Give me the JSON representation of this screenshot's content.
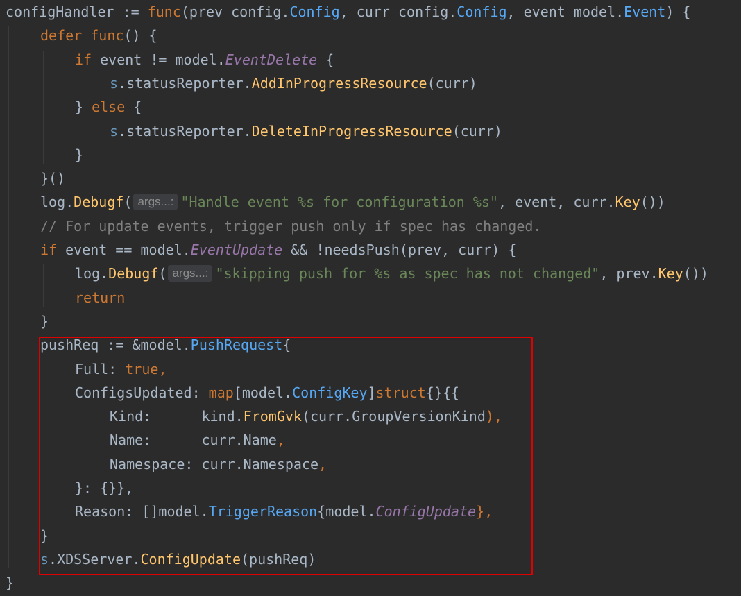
{
  "editor": {
    "highlight_color": "#e00000",
    "lines": [
      {
        "indent": 0,
        "tokens": [
          {
            "t": "configHandler",
            "c": "var"
          },
          {
            "t": " := ",
            "c": "punc"
          },
          {
            "t": "func",
            "c": "kw"
          },
          {
            "t": "(prev ",
            "c": "var"
          },
          {
            "t": "config",
            "c": "pkg"
          },
          {
            "t": ".",
            "c": "punc"
          },
          {
            "t": "Config",
            "c": "typeblue"
          },
          {
            "t": ", curr ",
            "c": "var"
          },
          {
            "t": "config",
            "c": "pkg"
          },
          {
            "t": ".",
            "c": "punc"
          },
          {
            "t": "Config",
            "c": "typeblue"
          },
          {
            "t": ", event ",
            "c": "var"
          },
          {
            "t": "model",
            "c": "pkg"
          },
          {
            "t": ".",
            "c": "punc"
          },
          {
            "t": "Event",
            "c": "typeblue"
          },
          {
            "t": ") {",
            "c": "punc"
          }
        ]
      },
      {
        "indent": 1,
        "tokens": [
          {
            "t": "defer ",
            "c": "kw"
          },
          {
            "t": "func",
            "c": "kw"
          },
          {
            "t": "() {",
            "c": "punc"
          }
        ]
      },
      {
        "indent": 2,
        "tokens": [
          {
            "t": "if ",
            "c": "kw"
          },
          {
            "t": "event != ",
            "c": "var"
          },
          {
            "t": "model",
            "c": "pkg"
          },
          {
            "t": ".",
            "c": "punc"
          },
          {
            "t": "EventDelete",
            "c": "const"
          },
          {
            "t": " {",
            "c": "punc"
          }
        ]
      },
      {
        "indent": 3,
        "tokens": [
          {
            "t": "s",
            "c": "recv"
          },
          {
            "t": ".statusReporter.",
            "c": "var"
          },
          {
            "t": "AddInProgressResource",
            "c": "method"
          },
          {
            "t": "(curr)",
            "c": "punc"
          }
        ]
      },
      {
        "indent": 2,
        "tokens": [
          {
            "t": "} ",
            "c": "punc"
          },
          {
            "t": "else",
            "c": "kw"
          },
          {
            "t": " {",
            "c": "punc"
          }
        ]
      },
      {
        "indent": 3,
        "tokens": [
          {
            "t": "s",
            "c": "recv"
          },
          {
            "t": ".statusReporter.",
            "c": "var"
          },
          {
            "t": "DeleteInProgressResource",
            "c": "method"
          },
          {
            "t": "(curr)",
            "c": "punc"
          }
        ]
      },
      {
        "indent": 2,
        "tokens": [
          {
            "t": "}",
            "c": "punc"
          }
        ]
      },
      {
        "indent": 1,
        "tokens": [
          {
            "t": "}()",
            "c": "punc"
          }
        ]
      },
      {
        "indent": 1,
        "tokens": [
          {
            "t": "log",
            "c": "pkg"
          },
          {
            "t": ".",
            "c": "punc"
          },
          {
            "t": "Debugf",
            "c": "method"
          },
          {
            "t": "(",
            "c": "punc"
          },
          {
            "hint": "args...:"
          },
          {
            "t": "\"Handle event %s for configuration %s\"",
            "c": "str"
          },
          {
            "t": ", event, curr.",
            "c": "var"
          },
          {
            "t": "Key",
            "c": "method"
          },
          {
            "t": "())",
            "c": "punc"
          }
        ]
      },
      {
        "indent": 1,
        "tokens": [
          {
            "t": "// For update events, trigger push only if spec has changed.",
            "c": "cm"
          }
        ]
      },
      {
        "indent": 1,
        "tokens": [
          {
            "t": "if ",
            "c": "kw"
          },
          {
            "t": "event == ",
            "c": "var"
          },
          {
            "t": "model",
            "c": "pkg"
          },
          {
            "t": ".",
            "c": "punc"
          },
          {
            "t": "EventUpdate",
            "c": "const"
          },
          {
            "t": " && !",
            "c": "punc"
          },
          {
            "t": "needsPush",
            "c": "meth2"
          },
          {
            "t": "(prev, curr) {",
            "c": "punc"
          }
        ]
      },
      {
        "indent": 2,
        "tokens": [
          {
            "t": "log",
            "c": "pkg"
          },
          {
            "t": ".",
            "c": "punc"
          },
          {
            "t": "Debugf",
            "c": "method"
          },
          {
            "t": "(",
            "c": "punc"
          },
          {
            "hint": "args...:"
          },
          {
            "t": "\"skipping push for %s as spec has not changed\"",
            "c": "str"
          },
          {
            "t": ", prev.",
            "c": "var"
          },
          {
            "t": "Key",
            "c": "method"
          },
          {
            "t": "())",
            "c": "punc"
          }
        ]
      },
      {
        "indent": 2,
        "tokens": [
          {
            "t": "return",
            "c": "kw"
          }
        ]
      },
      {
        "indent": 1,
        "tokens": [
          {
            "t": "}",
            "c": "punc"
          }
        ]
      },
      {
        "indent": 1,
        "tokens": [
          {
            "t": "pushReq",
            "c": "var"
          },
          {
            "t": " := &",
            "c": "punc"
          },
          {
            "t": "model",
            "c": "pkg"
          },
          {
            "t": ".",
            "c": "punc"
          },
          {
            "t": "PushRequest",
            "c": "typeblue"
          },
          {
            "t": "{",
            "c": "punc"
          }
        ]
      },
      {
        "indent": 2,
        "tokens": [
          {
            "t": "Full",
            "c": "field"
          },
          {
            "t": ": ",
            "c": "punc"
          },
          {
            "t": "true",
            "c": "kw"
          },
          {
            "t": ",",
            "c": "kw"
          }
        ]
      },
      {
        "indent": 2,
        "tokens": [
          {
            "t": "ConfigsUpdated",
            "c": "field"
          },
          {
            "t": ": ",
            "c": "punc"
          },
          {
            "t": "map",
            "c": "kw"
          },
          {
            "t": "[",
            "c": "punc"
          },
          {
            "t": "model",
            "c": "pkg"
          },
          {
            "t": ".",
            "c": "punc"
          },
          {
            "t": "ConfigKey",
            "c": "typeblue"
          },
          {
            "t": "]",
            "c": "punc"
          },
          {
            "t": "struct",
            "c": "kw"
          },
          {
            "t": "{}{{",
            "c": "punc"
          }
        ]
      },
      {
        "indent": 3,
        "tokens": [
          {
            "t": "Kind:      ",
            "c": "field"
          },
          {
            "t": "kind",
            "c": "pkg"
          },
          {
            "t": ".",
            "c": "punc"
          },
          {
            "t": "FromGvk",
            "c": "method"
          },
          {
            "t": "(curr.",
            "c": "punc"
          },
          {
            "t": "GroupVersionKind",
            "c": "var"
          },
          {
            "t": "),",
            "c": "kw"
          }
        ]
      },
      {
        "indent": 3,
        "tokens": [
          {
            "t": "Name:      ",
            "c": "field"
          },
          {
            "t": "curr.Name",
            "c": "var"
          },
          {
            "t": ",",
            "c": "kw"
          }
        ]
      },
      {
        "indent": 3,
        "tokens": [
          {
            "t": "Namespace: ",
            "c": "field"
          },
          {
            "t": "curr.Namespace",
            "c": "var"
          },
          {
            "t": ",",
            "c": "kw"
          }
        ]
      },
      {
        "indent": 2,
        "tokens": [
          {
            "t": "}: {}},",
            "c": "punc"
          }
        ]
      },
      {
        "indent": 2,
        "tokens": [
          {
            "t": "Reason",
            "c": "field"
          },
          {
            "t": ": []",
            "c": "punc"
          },
          {
            "t": "model",
            "c": "pkg"
          },
          {
            "t": ".",
            "c": "punc"
          },
          {
            "t": "TriggerReason",
            "c": "typeblue"
          },
          {
            "t": "{",
            "c": "punc"
          },
          {
            "t": "model",
            "c": "pkg"
          },
          {
            "t": ".",
            "c": "punc"
          },
          {
            "t": "ConfigUpdate",
            "c": "const"
          },
          {
            "t": "},",
            "c": "kw"
          }
        ]
      },
      {
        "indent": 1,
        "tokens": [
          {
            "t": "}",
            "c": "punc"
          }
        ]
      },
      {
        "indent": 1,
        "tokens": [
          {
            "t": "s",
            "c": "recv"
          },
          {
            "t": ".XDSServer.",
            "c": "var"
          },
          {
            "t": "ConfigUpdate",
            "c": "method"
          },
          {
            "t": "(pushReq)",
            "c": "punc"
          }
        ]
      },
      {
        "indent": 0,
        "tokens": [
          {
            "t": "}",
            "c": "punc"
          }
        ]
      }
    ]
  }
}
